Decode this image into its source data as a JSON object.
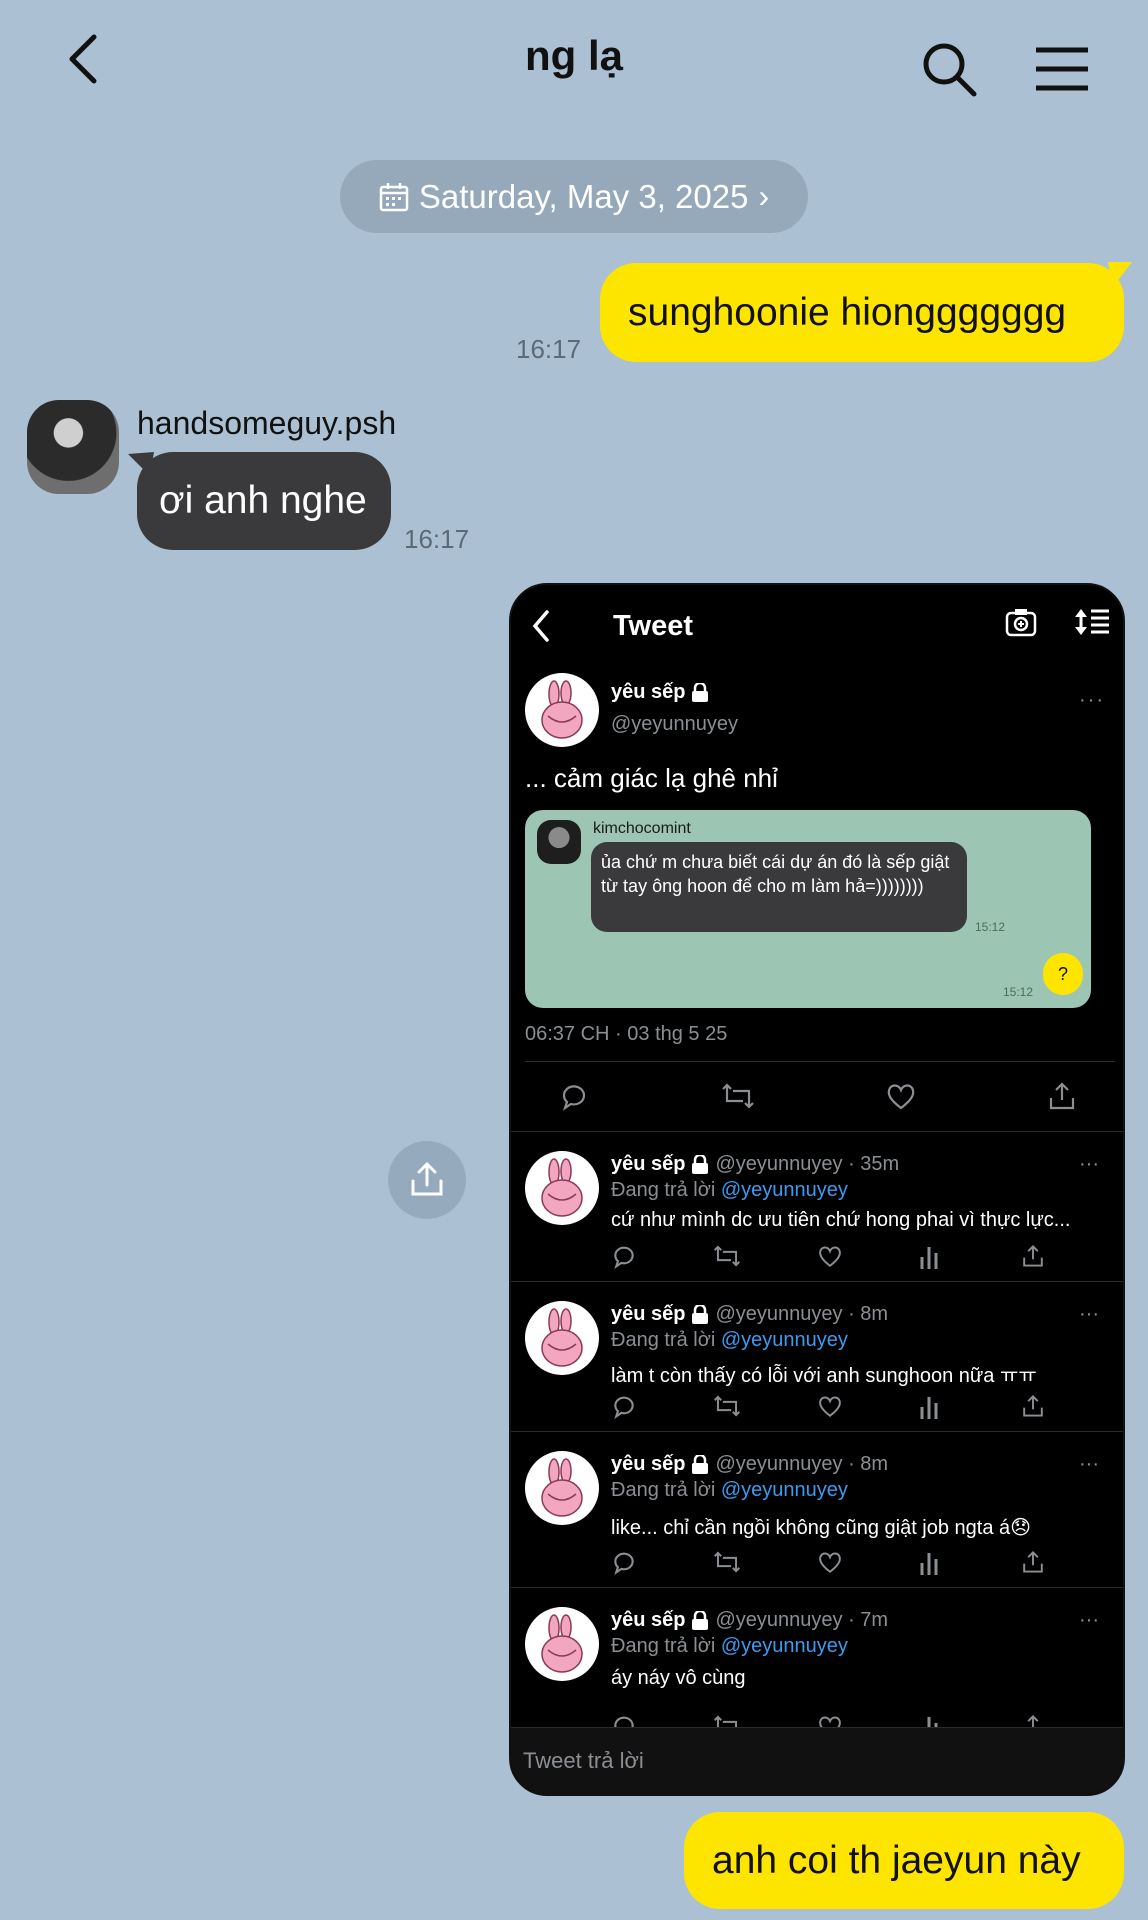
{
  "header": {
    "title": "ng lạ"
  },
  "date_pill": {
    "label": "Saturday, May 3, 2025",
    "chevron": "›"
  },
  "messages": [
    {
      "sender": "me",
      "text": "sunghoonie hionggggggg",
      "time": "16:17"
    },
    {
      "sender": "handsomeguy.psh",
      "text": "ơi anh nghe",
      "time": "16:17"
    },
    {
      "sender": "me",
      "text": "anh coi th jaeyun này"
    }
  ],
  "tweet": {
    "header_title": "Tweet",
    "author_name": "yêu sếp",
    "author_handle": "@yeyunnuyey",
    "text": "... cảm giác lạ ghê nhỉ",
    "embedded_chat": {
      "sender": "kimchocomint",
      "message": "ủa chứ m chưa biết cái dự án đó là sếp giật từ tay ông hoon để cho m làm hả=))))))))",
      "message_time": "15:12",
      "reply": "?",
      "reply_time": "15:12"
    },
    "timestamp": "06:37 CH · 03 thg 5 25",
    "compose_placeholder": "Tweet trả lời",
    "replies": [
      {
        "name": "yêu sếp",
        "handle_time": "@yeyunnuyey · 35m",
        "replying_prefix": "Đang trả lời",
        "replying_to": "@yeyunnuyey",
        "text": "cứ như mình dc ưu tiên chứ hong phai vì thực lực..."
      },
      {
        "name": "yêu sếp",
        "handle_time": "@yeyunnuyey · 8m",
        "replying_prefix": "Đang trả lời",
        "replying_to": "@yeyunnuyey",
        "text": "làm t còn thấy có lỗi với anh sunghoon nữa ㅠㅠ"
      },
      {
        "name": "yêu sếp",
        "handle_time": "@yeyunnuyey · 8m",
        "replying_prefix": "Đang trả lời",
        "replying_to": "@yeyunnuyey",
        "text": "like... chỉ cần ngồi không cũng giật job ngta á😞"
      },
      {
        "name": "yêu sếp",
        "handle_time": "@yeyunnuyey · 7m",
        "replying_prefix": "Đang trả lời",
        "replying_to": "@yeyunnuyey",
        "text": "áy náy vô cùng"
      }
    ]
  },
  "colors": {
    "background": "#abc1d3",
    "my_bubble": "#fee500",
    "their_bubble": "#3a3a3c",
    "date_pill": "#95a9bb",
    "embed_chat_bg": "#9cc6b3",
    "mention": "#3c9bf0"
  },
  "icons": {
    "back": "chevron-left-icon",
    "search": "search-icon",
    "menu": "hamburger-menu-icon",
    "calendar": "calendar-icon",
    "share": "share-icon"
  }
}
